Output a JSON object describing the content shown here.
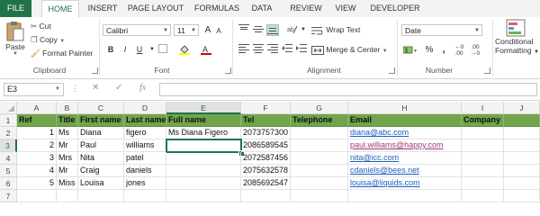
{
  "tabs": [
    "FILE",
    "HOME",
    "INSERT",
    "PAGE LAYOUT",
    "FORMULAS",
    "DATA",
    "REVIEW",
    "VIEW",
    "DEVELOPER"
  ],
  "ribbon": {
    "clipboard": {
      "paste": "Paste",
      "cut": "Cut",
      "copy": "Copy",
      "format_painter": "Format Painter",
      "label": "Clipboard"
    },
    "font": {
      "name": "Calibri",
      "size": "11",
      "bold": "B",
      "italic": "I",
      "underline": "U",
      "grow": "A",
      "shrink": "A",
      "label": "Font"
    },
    "alignment": {
      "wrap_text": "Wrap Text",
      "merge_center": "Merge & Center",
      "label": "Alignment"
    },
    "number": {
      "format": "Date",
      "currency": "$",
      "percent": "%",
      "comma": ",",
      "label": "Number"
    },
    "styles": {
      "conditional": "Conditional",
      "formatting": "Formatting"
    }
  },
  "formula_bar": {
    "name_box": "E3",
    "fx": "fx",
    "cancel": "✕",
    "enter": "✓",
    "value": ""
  },
  "columns": [
    "A",
    "B",
    "C",
    "D",
    "E",
    "F",
    "G",
    "H",
    "I",
    "J"
  ],
  "rows": [
    "1",
    "2",
    "3",
    "4",
    "5",
    "6",
    "7"
  ],
  "table": {
    "header": [
      "Ref",
      "Title",
      "First name",
      "Last name",
      "Full name",
      "Tel",
      "Telephone",
      "Email",
      "Company"
    ],
    "data": [
      [
        "1",
        "Ms",
        "Diana",
        "figero",
        "Ms Diana Figero",
        "2073757300",
        "",
        "diana@abc.com",
        ""
      ],
      [
        "2",
        "Mr",
        "Paul",
        "williams",
        "",
        "2086589545",
        "",
        "paul.williams@happy.com",
        ""
      ],
      [
        "3",
        "Mrs",
        "Nita",
        "patel",
        "",
        "2072587456",
        "",
        "nita@icc.com",
        ""
      ],
      [
        "4",
        "Mr",
        "Craig",
        "daniels",
        "",
        "2075632578",
        "",
        "cdaniels@bees.net",
        ""
      ],
      [
        "5",
        "Miss",
        "Louisa",
        "jones",
        "",
        "2085692547",
        "",
        "louisa@liquids.com",
        ""
      ]
    ]
  },
  "colors": {
    "brand": "#217346",
    "header_fill": "#70a54c",
    "link": "#1f5fbf",
    "visited": "#9c3b74"
  }
}
